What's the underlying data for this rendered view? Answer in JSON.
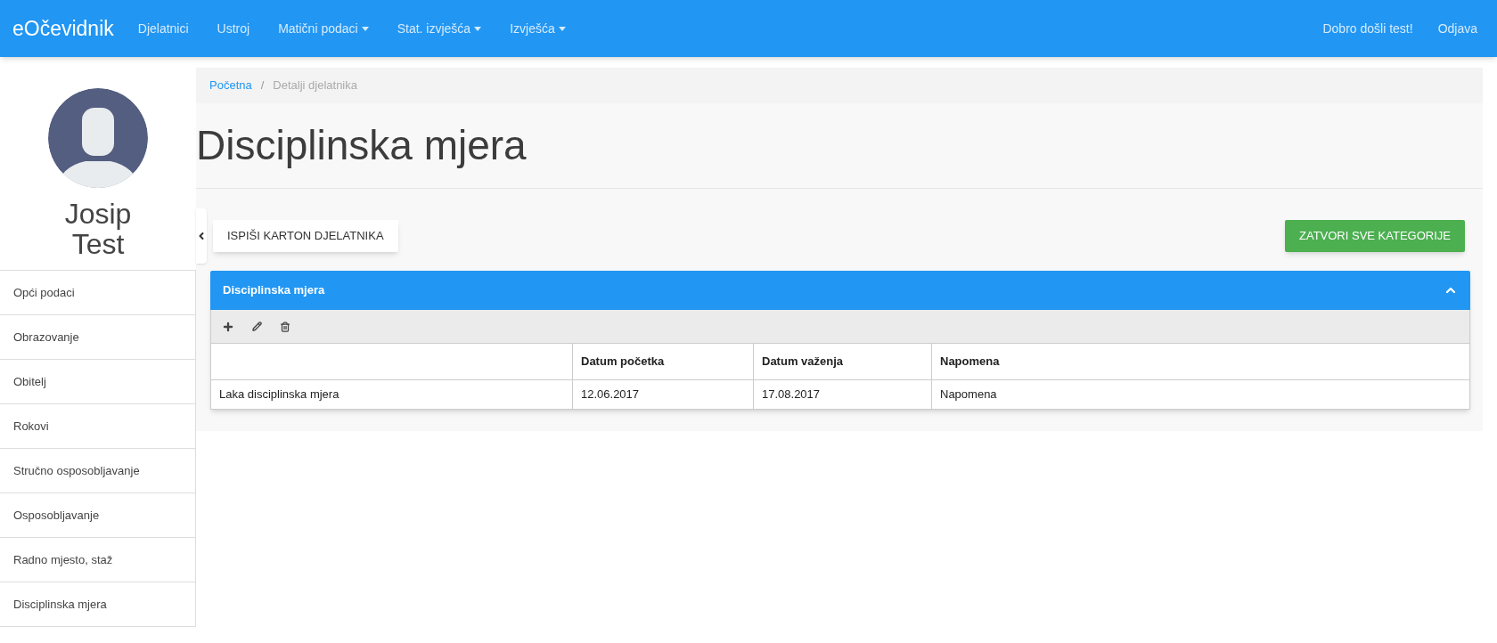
{
  "navbar": {
    "brand": "eOčevidnik",
    "items": [
      {
        "label": "Djelatnici",
        "dropdown": false
      },
      {
        "label": "Ustroj",
        "dropdown": false
      },
      {
        "label": "Matični podaci",
        "dropdown": true
      },
      {
        "label": "Stat. izvješća",
        "dropdown": true
      },
      {
        "label": "Izvješća",
        "dropdown": true
      }
    ],
    "right": [
      "Dobro došli test!",
      "Odjava"
    ]
  },
  "sidebar": {
    "name": "Josip Test",
    "items": [
      "Opći podaci",
      "Obrazovanje",
      "Obitelj",
      "Rokovi",
      "Stručno osposobljavanje",
      "Osposobljavanje",
      "Radno mjesto, staž",
      "Disciplinska mjera"
    ]
  },
  "breadcrumb_separator": "/",
  "breadcrumb": [
    {
      "label": "Početna",
      "link": true
    },
    {
      "label": "Detalji djelatnika",
      "link": false
    }
  ],
  "page_title": "Disciplinska mjera",
  "buttons": {
    "print": "ISPIŠI KARTON DJELATNIKA",
    "close_all": "ZATVORI SVE KATEGORIJE"
  },
  "panel": {
    "title": "Disciplinska mjera",
    "expanded": true,
    "table": {
      "columns": [
        "",
        "Datum početka",
        "Datum važenja",
        "Napomena"
      ],
      "rows": [
        [
          "Laka disciplinska mjera",
          "12.06.2017",
          "17.08.2017",
          "Napomena"
        ]
      ]
    }
  }
}
